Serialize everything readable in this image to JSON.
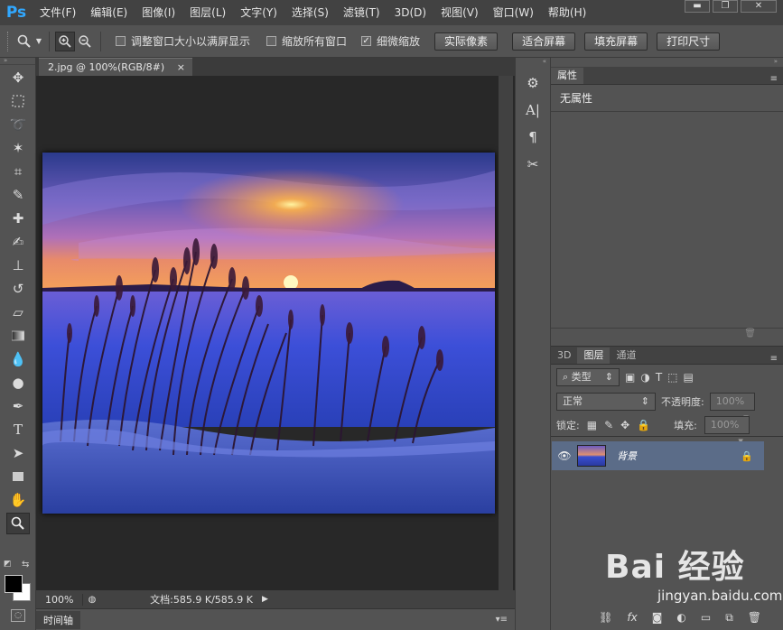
{
  "app": {
    "logo": "Ps"
  },
  "menu": [
    "文件(F)",
    "编辑(E)",
    "图像(I)",
    "图层(L)",
    "文字(Y)",
    "选择(S)",
    "滤镜(T)",
    "3D(D)",
    "视图(V)",
    "窗口(W)",
    "帮助(H)"
  ],
  "window_controls": {
    "minimize": "▬",
    "restore": "❐",
    "close": "✕"
  },
  "options": {
    "check_resize_windows": "调整窗口大小以满屏显示",
    "check_zoom_all": "缩放所有窗口",
    "check_scrubby_zoom": "细微缩放",
    "btn_actual_pixels": "实际像素",
    "btn_fit_screen": "适合屏幕",
    "btn_fill_screen": "填充屏幕",
    "btn_print_size": "打印尺寸"
  },
  "document": {
    "tab_label": "2.jpg @ 100%(RGB/8#)",
    "tab_close": "×",
    "zoom": "100%",
    "doc_info": "文档:585.9 K/585.9 K"
  },
  "timeline": {
    "label": "时间轴"
  },
  "properties": {
    "tab": "属性",
    "content": "无属性"
  },
  "layers_panel": {
    "tabs": [
      "3D",
      "图层",
      "通道"
    ],
    "filter_kind": "类型",
    "blend_mode": "正常",
    "opacity_label": "不透明度:",
    "opacity_value": "100%",
    "lock_label": "锁定:",
    "fill_label": "填充:",
    "fill_value": "100%",
    "layers": [
      {
        "name": "背景",
        "visible": true,
        "locked": true
      }
    ]
  },
  "watermark": {
    "brand": "Bai 经验",
    "url": "jingyan.baidu.com"
  }
}
